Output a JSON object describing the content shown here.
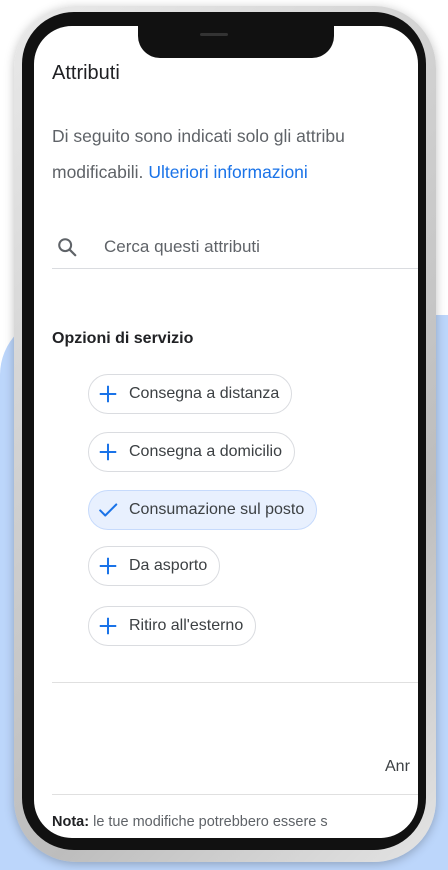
{
  "header": {
    "title": "Attributi"
  },
  "description": {
    "line1": "Di seguito sono indicati solo gli attribu",
    "line2_prefix": "modificabili.",
    "link": "Ulteriori informazioni"
  },
  "search": {
    "placeholder": "Cerca questi attributi",
    "icon": "search-icon"
  },
  "section": {
    "title": "Opzioni di servizio"
  },
  "options": [
    {
      "label": "Consegna a distanza",
      "selected": false,
      "icon": "plus-icon"
    },
    {
      "label": "Consegna a domicilio",
      "selected": false,
      "icon": "plus-icon"
    },
    {
      "label": "Consumazione sul posto",
      "selected": true,
      "icon": "check-icon"
    },
    {
      "label": "Da asporto",
      "selected": false,
      "icon": "plus-icon"
    },
    {
      "label": "Ritiro all'esterno",
      "selected": false,
      "icon": "plus-icon"
    }
  ],
  "footer": {
    "cancel_label": "Anr",
    "note_label": "Nota:",
    "note_text": " le tue modifiche potrebbero essere s"
  },
  "colors": {
    "accent": "#1a73e8",
    "selected_bg": "#e8f0fe",
    "backdrop": "#bcd6fb"
  }
}
